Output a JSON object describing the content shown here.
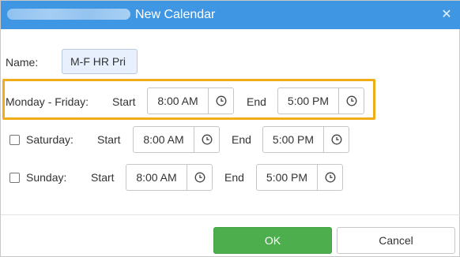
{
  "window": {
    "title": "New Calendar",
    "close_glyph": "✕"
  },
  "form": {
    "name_label": "Name:",
    "name_value": "M-F HR Pri",
    "rows": [
      {
        "day_label": "Monday - Friday:",
        "start_label": "Start",
        "start_time": "8:00 AM",
        "end_label": "End",
        "end_time": "5:00 PM",
        "highlighted": true,
        "has_checkbox": false
      },
      {
        "day_label": "Saturday:",
        "start_label": "Start",
        "start_time": "8:00 AM",
        "end_label": "End",
        "end_time": "5:00 PM",
        "checked": false,
        "has_checkbox": true
      },
      {
        "day_label": "Sunday:",
        "start_label": "Start",
        "start_time": "8:00 AM",
        "end_label": "End",
        "end_time": "5:00 PM",
        "checked": false,
        "has_checkbox": true
      }
    ]
  },
  "buttons": {
    "ok": "OK",
    "cancel": "Cancel"
  },
  "icons": {
    "time_picker": "clock-icon",
    "close": "close-icon"
  },
  "colors": {
    "title_bar": "#3f97e3",
    "highlight": "#f0ad19",
    "ok_button": "#4cae4c",
    "input_fill": "#e8f0fe"
  }
}
